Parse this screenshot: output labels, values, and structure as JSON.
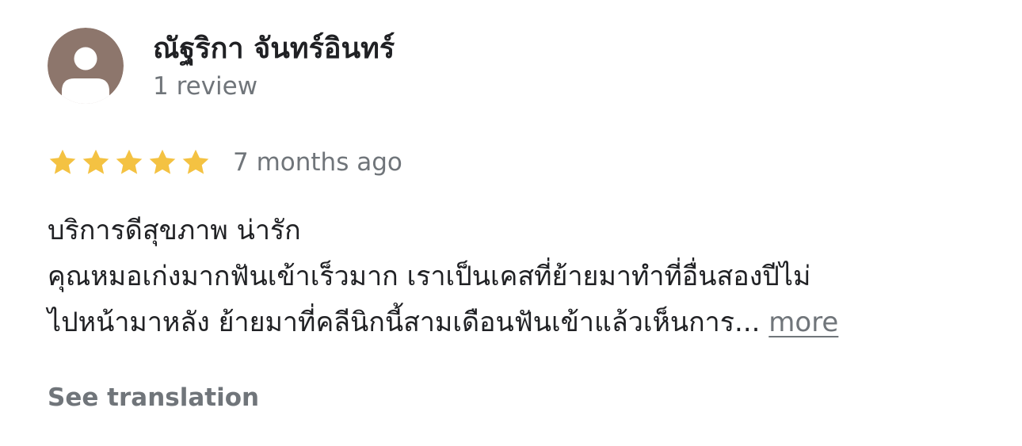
{
  "author": {
    "name": "ณัฐริกา จันทร์อินทร์",
    "review_count": "1 review",
    "avatar_icon": "default-person-avatar-icon",
    "avatar_color": "#8d766c"
  },
  "review": {
    "rating": 5,
    "max_rating": 5,
    "star_color": "#f4c242",
    "time_ago": "7 months ago",
    "lines": [
      "บริการดีสุขภาพ น่ารัก",
      "คุณหมอเก่งมากฟันเข้าเร็วมาก เราเป็นเคสที่ย้ายมาทำที่อื่นสองปีไม่",
      "ไปหน้ามาหลัง  ย้ายมาที่คลีนิกนี้สามเดือนฟันเข้าแล้วเห็นการ..."
    ],
    "more_label": "more"
  },
  "see_translation_label": "See translation"
}
